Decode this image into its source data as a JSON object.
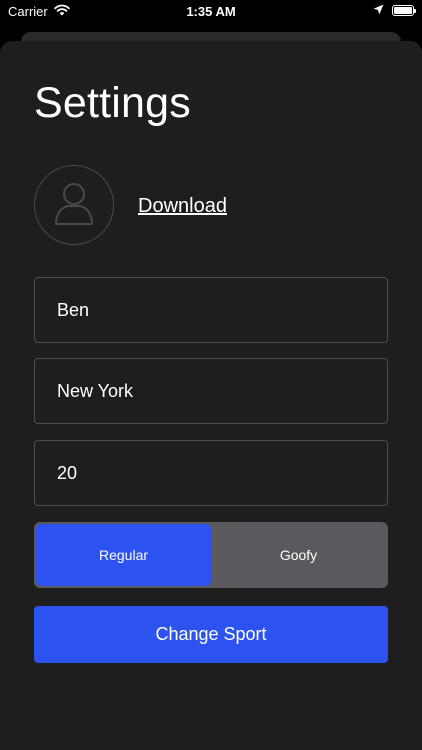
{
  "status_bar": {
    "carrier": "Carrier",
    "time": "1:35 AM",
    "icons": [
      "wifi-icon",
      "location-arrow-icon",
      "battery-icon"
    ]
  },
  "header": {
    "title": "Settings"
  },
  "profile": {
    "avatar_icon": "user-icon",
    "download_label": "Download"
  },
  "form": {
    "name_value": "Ben",
    "city_value": "New York",
    "age_value": "20"
  },
  "stance": {
    "options": [
      "Regular",
      "Goofy"
    ],
    "selected": "Regular"
  },
  "actions": {
    "change_sport_label": "Change Sport"
  },
  "colors": {
    "background": "#000000",
    "sheet": "#1e1e1e",
    "accent": "#2c53f0",
    "segment_bg": "#5a5a5e",
    "field_border": "#4d4d4d"
  }
}
